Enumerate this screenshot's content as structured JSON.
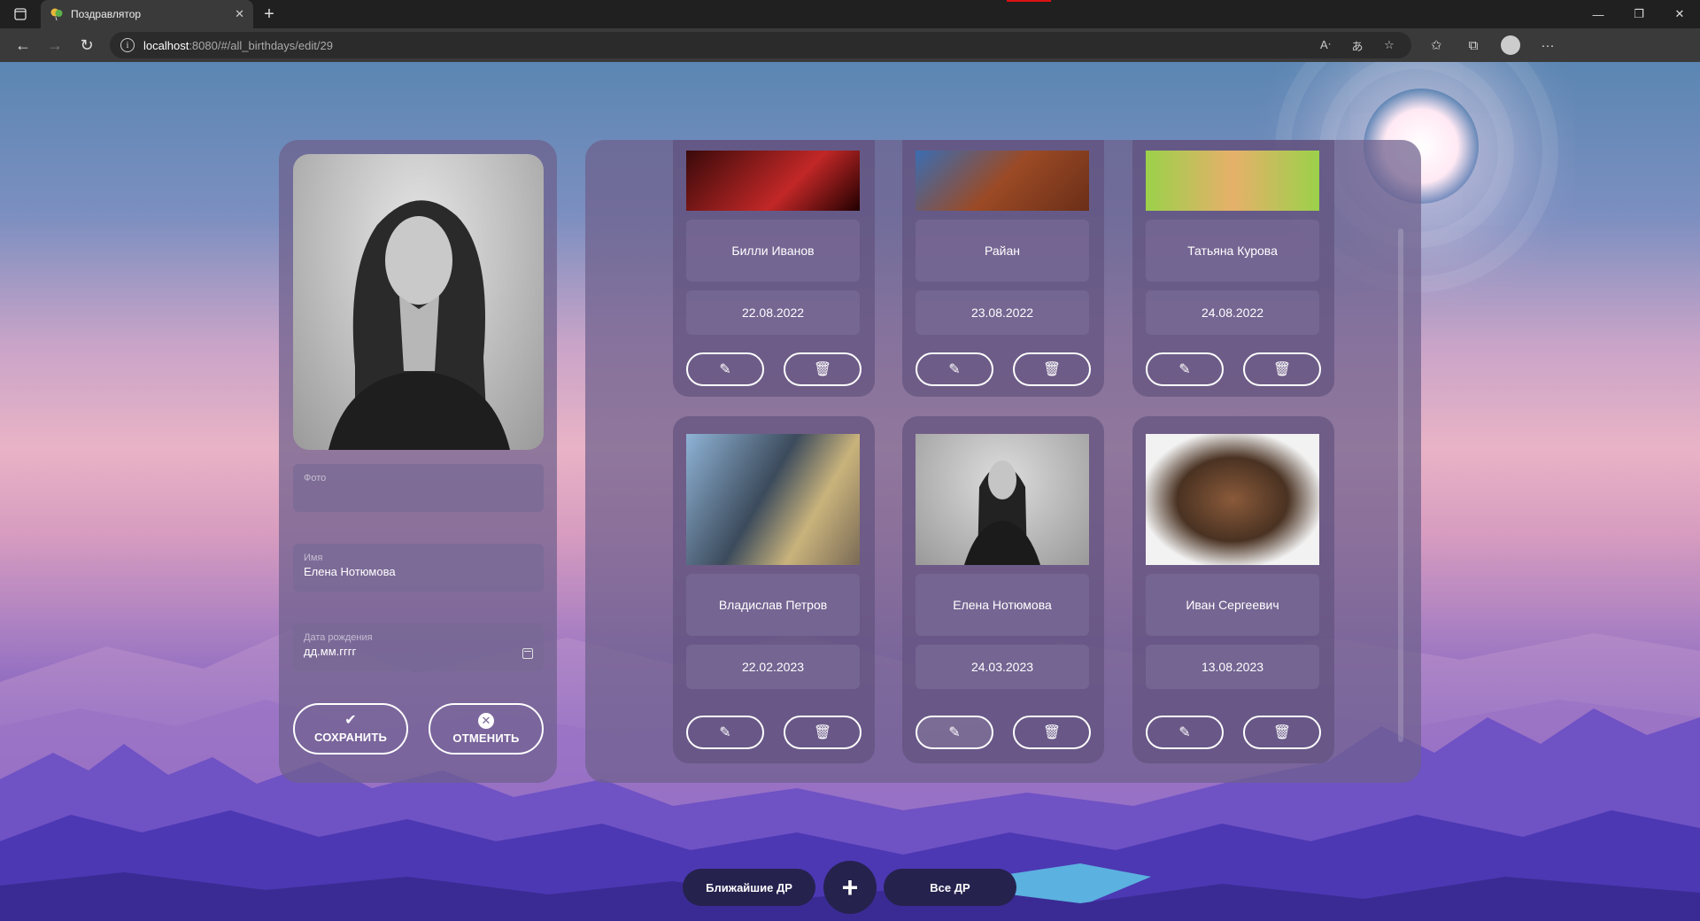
{
  "browser": {
    "tab_title": "Поздравлятор",
    "url_host": "localhost",
    "url_rest": ":8080/#/all_birthdays/edit/29"
  },
  "edit_form": {
    "photo_label": "Фото",
    "name_label": "Имя",
    "name_value": "Елена Нотюмова",
    "birthdate_label": "Дата рождения",
    "birthdate_placeholder": "дд.мм.гггг",
    "save_label": "СОХРАНИТЬ",
    "cancel_label": "ОТМЕНИТЬ"
  },
  "cards": [
    {
      "name": "Билли Иванов",
      "date": "22.08.2022"
    },
    {
      "name": "Райан",
      "date": "23.08.2022"
    },
    {
      "name": "Татьяна Курова",
      "date": "24.08.2022"
    },
    {
      "name": "Владислав Петров",
      "date": "22.02.2023"
    },
    {
      "name": "Елена Нотюмова",
      "date": "24.03.2023"
    },
    {
      "name": "Иван Сергеевич",
      "date": "13.08.2023"
    }
  ],
  "bottom_nav": {
    "nearest_label": "Ближайшие ДР",
    "add_label": "+",
    "all_label": "Все ДР"
  },
  "icons": {
    "edit": "pencil-icon",
    "delete": "trash-icon",
    "save": "check-icon",
    "cancel": "close-circle-icon"
  }
}
